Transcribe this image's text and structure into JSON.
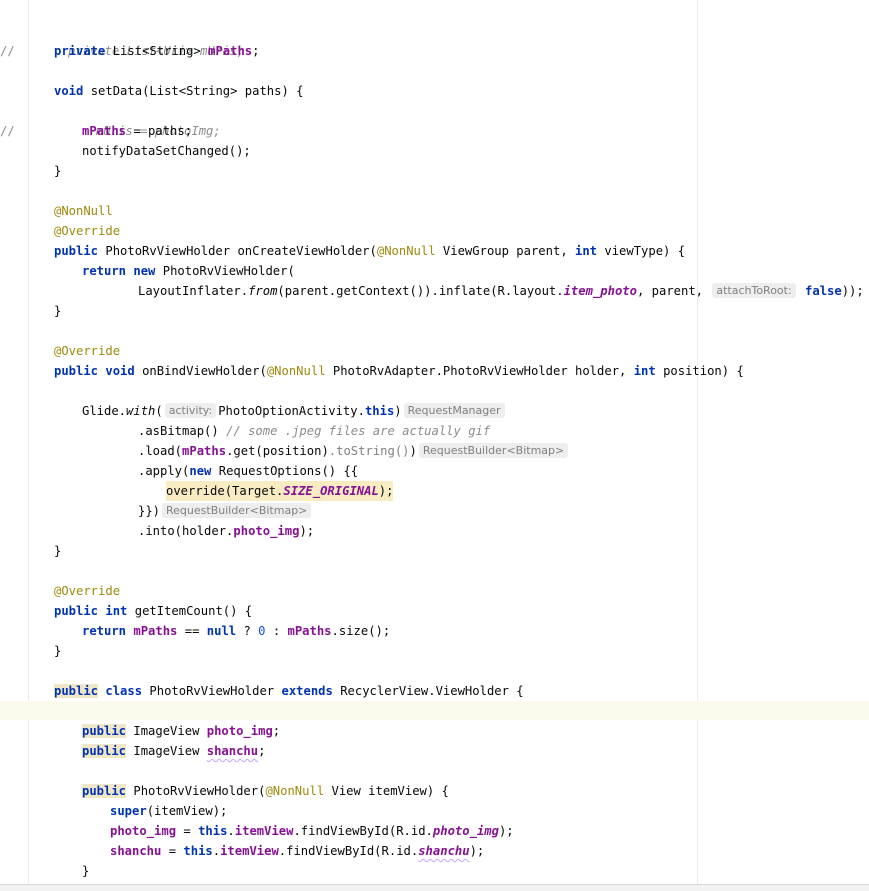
{
  "code": {
    "l1": {
      "comment_marker": "//",
      "comment_code": "private List<Uri> mUris;"
    },
    "l2": {
      "kw": "private",
      "type": "List<String>",
      "field": "mPaths",
      "end": ";"
    },
    "l4": {
      "kw": "void",
      "sig": "setData(List<String> paths) {"
    },
    "l5": {
      "comment_marker": "//",
      "comment_code": "mUris = photoImg;"
    },
    "l6": {
      "field": "mPaths",
      "rest": " = paths;"
    },
    "l7": {
      "text": "notifyDataSetChanged();"
    },
    "l8": {
      "text": "}"
    },
    "l10": {
      "ann": "@NonNull"
    },
    "l11": {
      "ann": "@Override"
    },
    "l12": {
      "kw": "public",
      "a": "PhotoRvViewHolder onCreateViewHolder(",
      "ann": "@NonNull",
      "b": " ViewGroup parent, ",
      "kw2": "int",
      "c": " viewType) {"
    },
    "l13": {
      "kw": "return",
      "kw2": "new",
      "rest": "PhotoRvViewHolder("
    },
    "l14": {
      "a": "LayoutInflater.",
      "m": "from",
      "b": "(parent.getContext()).inflate(R.layout.",
      "f": "item_photo",
      "c": ", parent, ",
      "hint": "attachToRoot:",
      "kw": "false",
      "d": "));"
    },
    "l15": {
      "text": "}"
    },
    "l17": {
      "ann": "@Override"
    },
    "l18": {
      "kw": "public",
      "kw2": "void",
      "a": "onBindViewHolder(",
      "ann": "@NonNull",
      "b": " PhotoRvAdapter.PhotoRvViewHolder holder, ",
      "kw3": "int",
      "c": " position) {"
    },
    "l20": {
      "a": "Glide.",
      "m": "with",
      "b": "(",
      "hint": "activity:",
      "c": "PhotoOptionActivity.",
      "kw": "this",
      "d": ")",
      "hint2": "RequestManager"
    },
    "l21": {
      "a": ".asBitmap() ",
      "comment": "// some .jpeg files are actually gif"
    },
    "l22": {
      "a": ".load(",
      "field": "mPaths",
      "b": ".get(position)",
      "dim": ".toString()",
      "c": ")",
      "hint": "RequestBuilder<Bitmap>"
    },
    "l23": {
      "a": ".apply(",
      "kw": "new",
      "b": " RequestOptions() {{"
    },
    "l24": {
      "a": "override(Target.",
      "st": "SIZE_ORIGINAL",
      "b": ");"
    },
    "l25": {
      "a": "}})",
      "hint": "RequestBuilder<Bitmap>"
    },
    "l26": {
      "a": ".into(holder.",
      "field": "photo_img",
      "b": ");"
    },
    "l27": {
      "text": "}"
    },
    "l29": {
      "ann": "@Override"
    },
    "l30": {
      "kw": "public",
      "kw2": "int",
      "a": "getItemCount() {"
    },
    "l31": {
      "kw": "return",
      "field": "mPaths",
      "a": " == ",
      "kw2": "null",
      "b": " ? ",
      "num": "0",
      "c": " : ",
      "field2": "mPaths",
      "d": ".size();"
    },
    "l32": {
      "text": "}"
    },
    "l34": {
      "kw": "public",
      "kw2": "class",
      "a": "PhotoRvViewHolder ",
      "kw3": "extends",
      "b": " RecyclerView.ViewHolder {"
    },
    "l36": {
      "kw": "public",
      "a": "ImageView ",
      "field": "photo_img",
      "b": ";"
    },
    "l37": {
      "kw": "public",
      "a": "ImageView ",
      "field": "shanchu",
      "b": ";"
    },
    "l39": {
      "kw": "public",
      "a": "PhotoRvViewHolder(",
      "ann": "@NonNull",
      "b": " View itemView) {"
    },
    "l40": {
      "kw": "super",
      "a": "(itemView);"
    },
    "l41": {
      "field": "photo_img",
      "a": " = ",
      "kw": "this",
      "b": ".",
      "field2": "itemView",
      "c": ".findViewById(R.id.",
      "fi": "photo_img",
      "d": ");"
    },
    "l42": {
      "field": "shanchu",
      "a": " = ",
      "kw": "this",
      "b": ".",
      "field2": "itemView",
      "c": ".findViewById(R.id.",
      "fi": "shanchu",
      "d": ");"
    },
    "l43": {
      "text": "}"
    }
  }
}
